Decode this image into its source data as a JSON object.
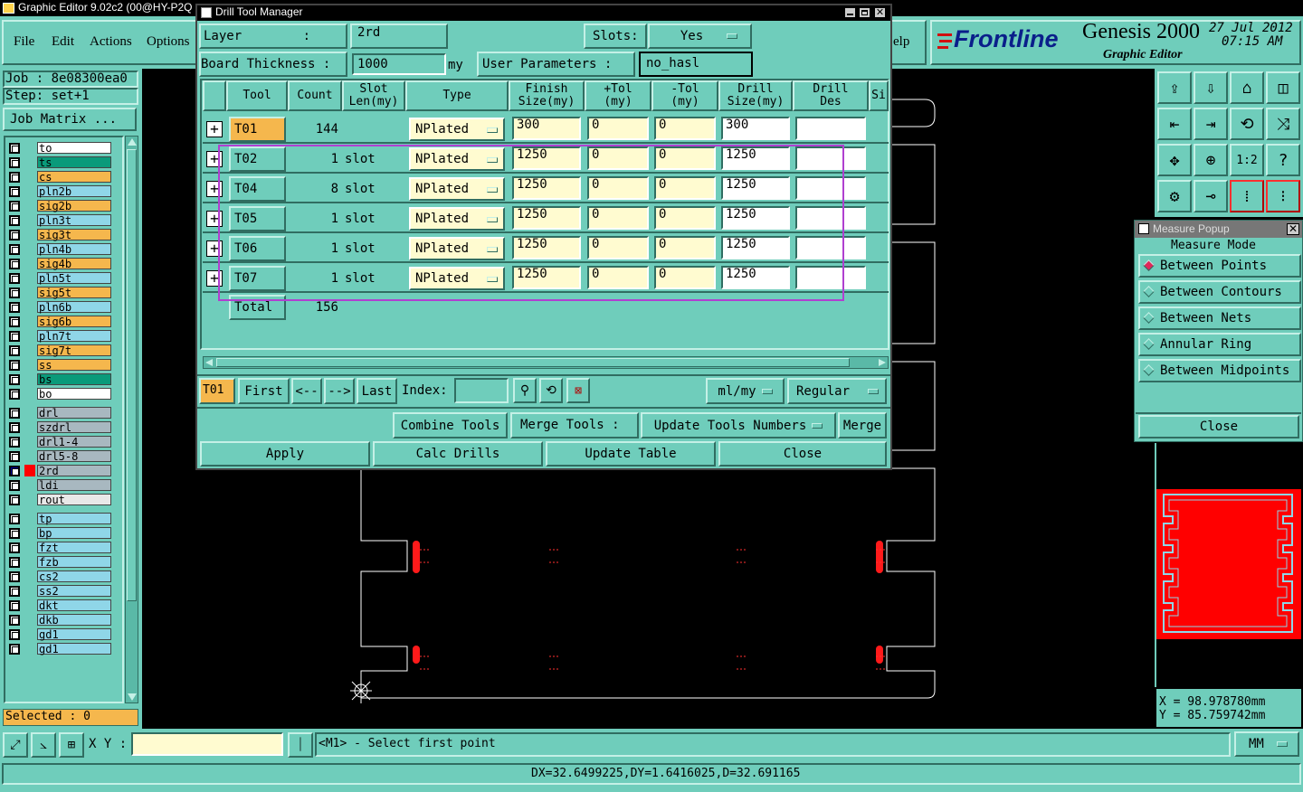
{
  "app": {
    "title": "Graphic Editor 9.02c2 (00@HY-P2Q"
  },
  "menubar": {
    "items": [
      "File",
      "Edit",
      "Actions",
      "Options"
    ],
    "help_fragment": "elp"
  },
  "brand": {
    "logo": "Frontline",
    "product": "Genesis 2000",
    "date": "27 Jul 2012",
    "time": "07:15 AM",
    "subtitle": "Graphic Editor"
  },
  "job": {
    "job_label": "Job : 8e08300ea0",
    "step_label": "Step: set+1",
    "matrix_button": "Job Matrix ..."
  },
  "layers": [
    {
      "name": "to",
      "color": "#ffffff"
    },
    {
      "name": "ts",
      "color": "#0a9a7a"
    },
    {
      "name": "cs",
      "color": "#f5b74d"
    },
    {
      "name": "pln2b",
      "color": "#8fd6e8"
    },
    {
      "name": "sig2b",
      "color": "#f5b74d"
    },
    {
      "name": "pln3t",
      "color": "#8fd6e8"
    },
    {
      "name": "sig3t",
      "color": "#f5b74d"
    },
    {
      "name": "pln4b",
      "color": "#8fd6e8"
    },
    {
      "name": "sig4b",
      "color": "#f5b74d"
    },
    {
      "name": "pln5t",
      "color": "#8fd6e8"
    },
    {
      "name": "sig5t",
      "color": "#f5b74d"
    },
    {
      "name": "pln6b",
      "color": "#8fd6e8"
    },
    {
      "name": "sig6b",
      "color": "#f5b74d"
    },
    {
      "name": "pln7t",
      "color": "#8fd6e8"
    },
    {
      "name": "sig7t",
      "color": "#f5b74d"
    },
    {
      "name": "ss",
      "color": "#f5b74d"
    },
    {
      "name": "bs",
      "color": "#0a9a7a"
    },
    {
      "name": "bo",
      "color": "#ffffff"
    },
    {
      "name": "drl",
      "color": "#a8b8c0"
    },
    {
      "name": "szdrl",
      "color": "#a8b8c0"
    },
    {
      "name": "drl1-4",
      "color": "#a8b8c0"
    },
    {
      "name": "drl5-8",
      "color": "#a8b8c0"
    },
    {
      "name": "2rd",
      "color": "#a8b8c0"
    },
    {
      "name": "ldi",
      "color": "#a8b8c0"
    },
    {
      "name": "rout",
      "color": "#e8e8e8"
    },
    {
      "name": "tp",
      "color": "#8fd6e8"
    },
    {
      "name": "bp",
      "color": "#8fd6e8"
    },
    {
      "name": "fzt",
      "color": "#8fd6e8"
    },
    {
      "name": "fzb",
      "color": "#8fd6e8"
    },
    {
      "name": "cs2",
      "color": "#8fd6e8"
    },
    {
      "name": "ss2",
      "color": "#8fd6e8"
    },
    {
      "name": "dkt",
      "color": "#8fd6e8"
    },
    {
      "name": "dkb",
      "color": "#8fd6e8"
    },
    {
      "name": "gd1",
      "color": "#8fd6e8"
    },
    {
      "name": "gd1",
      "color": "#8fd6e8"
    }
  ],
  "selected_label": "Selected : 0",
  "drill_manager": {
    "title": "Drill Tool Manager",
    "layer_label": "Layer        :",
    "layer_value": "2rd",
    "slots_label": "Slots:",
    "slots_value": "Yes",
    "thickness_label": "Board Thickness :",
    "thickness_value": "1000",
    "thickness_unit": "my",
    "user_params_label": "User Parameters :",
    "user_params_value": "no_hasl",
    "columns": [
      "Tool",
      "Count",
      "Slot\nLen(my)",
      "Type",
      "Finish\nSize(my)",
      "+Tol\n(my)",
      "-Tol\n(my)",
      "Drill\nSize(my)",
      "Drill\nDes",
      "Si"
    ],
    "rows": [
      {
        "tool": "T01",
        "count": "144",
        "slot": "",
        "type": "NPlated",
        "finish": "300",
        "ptol": "0",
        "mtol": "0",
        "drill": "300",
        "des": ""
      },
      {
        "tool": "T02",
        "count": "1",
        "slot": "slot",
        "type": "NPlated",
        "finish": "1250",
        "ptol": "0",
        "mtol": "0",
        "drill": "1250",
        "des": ""
      },
      {
        "tool": "T04",
        "count": "8",
        "slot": "slot",
        "type": "NPlated",
        "finish": "1250",
        "ptol": "0",
        "mtol": "0",
        "drill": "1250",
        "des": ""
      },
      {
        "tool": "T05",
        "count": "1",
        "slot": "slot",
        "type": "NPlated",
        "finish": "1250",
        "ptol": "0",
        "mtol": "0",
        "drill": "1250",
        "des": ""
      },
      {
        "tool": "T06",
        "count": "1",
        "slot": "slot",
        "type": "NPlated",
        "finish": "1250",
        "ptol": "0",
        "mtol": "0",
        "drill": "1250",
        "des": ""
      },
      {
        "tool": "T07",
        "count": "1",
        "slot": "slot",
        "type": "NPlated",
        "finish": "1250",
        "ptol": "0",
        "mtol": "0",
        "drill": "1250",
        "des": ""
      }
    ],
    "total_label": "Total",
    "total_count": "156",
    "nav": {
      "current": "T01",
      "first": "First",
      "prev": "<--",
      "next": "-->",
      "last": "Last",
      "index_label": "Index:",
      "units": "ml/my",
      "mode": "Regular"
    },
    "actions": {
      "combine": "Combine Tools",
      "merge_tools": "Merge Tools :",
      "update_numbers": "Update Tools Numbers",
      "merge": "Merge"
    },
    "bottom": {
      "apply": "Apply",
      "calc": "Calc Drills",
      "update_table": "Update Table",
      "close": "Close"
    }
  },
  "measure": {
    "title": "Measure Popup",
    "mode_label": "Measure Mode",
    "options": [
      "Between Points",
      "Between Contours",
      "Between Nets",
      "Annular Ring",
      "Between Midpoints"
    ],
    "selected": "Between Points",
    "close": "Close"
  },
  "coords": {
    "x": "X = 98.978780mm",
    "y": "Y = 85.759742mm"
  },
  "statusbar": {
    "xy_label": "X Y :",
    "xy_value": "",
    "prompt": "<M1> - Select first point",
    "units": "MM",
    "measurement": "DX=32.6499225,DY=1.6416025,D=32.691165"
  }
}
